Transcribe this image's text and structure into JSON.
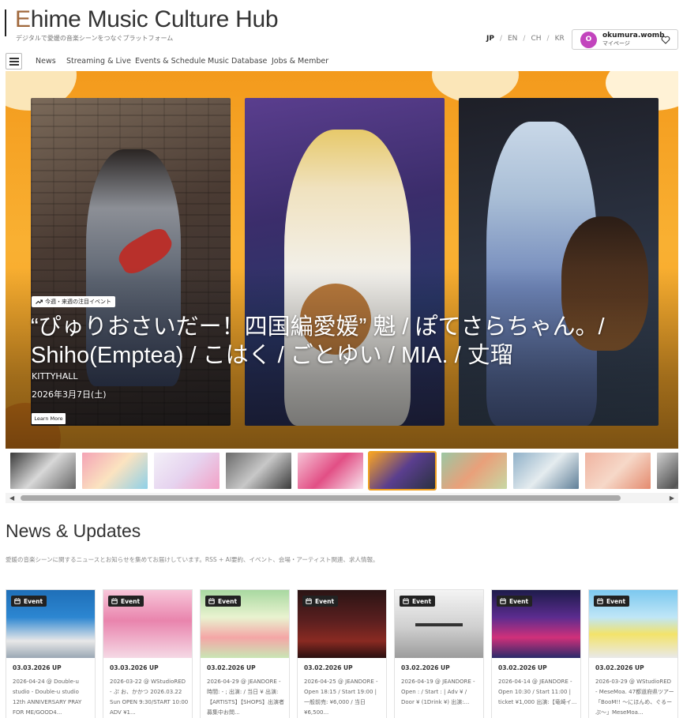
{
  "header": {
    "brand_first_letter": "E",
    "brand_rest": "hime Music Culture Hub",
    "tagline": "デジタルで愛媛の音楽シーンをつなぐプラットフォーム",
    "languages": [
      "JP",
      "EN",
      "CH",
      "KR"
    ],
    "active_language": "JP",
    "user": {
      "initial": "O",
      "name": "okumura.womb",
      "link_label": "マイページ",
      "avatar_color": "#c244bd"
    }
  },
  "nav": {
    "items": [
      "News",
      "Streaming & Live",
      "Events & Schedule",
      "Music Database",
      "Jobs & Member"
    ]
  },
  "hero": {
    "tag": "今週・来週の注目イベント",
    "title": "“ぴゅりおさいだー！四国編愛媛” 魁 / ぽてさらちゃん。/ Shiho(Emptea) / こはく / ごとゆい / MIA. / 丈瑠",
    "venue": "KITTYHALL",
    "date": "2026年3月7日(土)",
    "learn_more": "Learn More",
    "background_color": "#f7a325"
  },
  "thumbnail_strip": {
    "count": 10,
    "active_index": 5
  },
  "news": {
    "title": "News & Updates",
    "description": "愛媛の音楽シーンに関するニュースとお知らせを集めてお届けしています。RSS + AI要約、イベント、会場・アーティスト関連、求人情報。",
    "cards": [
      {
        "badge": "Event",
        "date": "03.03.2026 UP",
        "text": "2026-04-24 @ Double-u studio - Double-u studio 12th ANNIVERSARY PRAY FOR ME/GOOD4..."
      },
      {
        "badge": "Event",
        "date": "03.03.2026 UP",
        "text": "2026-03-22 @ WStudioRED - ぷ お、かかつ 2026.03.22 Sun OPEN 9:30/START 10:00 ADV ¥1..."
      },
      {
        "badge": "Event",
        "date": "03.02.2026 UP",
        "text": "2026-04-29 @ JEANDORE - 時間: - ; 出演: / 当日 ¥ 出演: 【ARTISTS】【SHOPS】出演者募集中お問..."
      },
      {
        "badge": "Event",
        "date": "03.02.2026 UP",
        "text": "2026-04-25 @ JEANDORE - Open 18:15 / Start 19:00 | 一般前売: ¥6,000 / 当日 ¥6,500..."
      },
      {
        "badge": "Event",
        "date": "03.02.2026 UP",
        "text": "2026-04-19 @ JEANDORE - Open : / Start : | Adv ¥ / Door ¥ (1Drink ¥) 出演:..."
      },
      {
        "badge": "Event",
        "date": "03.02.2026 UP",
        "text": "2026-04-14 @ JEANDORE - Open 10:30 / Start 11:00 | ticket ¥1,000 出演:【竜崎イ..."
      },
      {
        "badge": "Event",
        "date": "03.02.2026 UP",
        "text": "2026-03-29 @ WStudioRED - MeseMoa. 47都道府県ツアー「BooM!! ～にほんめ、ぐるーぷ～」MeseMoa..."
      }
    ]
  }
}
